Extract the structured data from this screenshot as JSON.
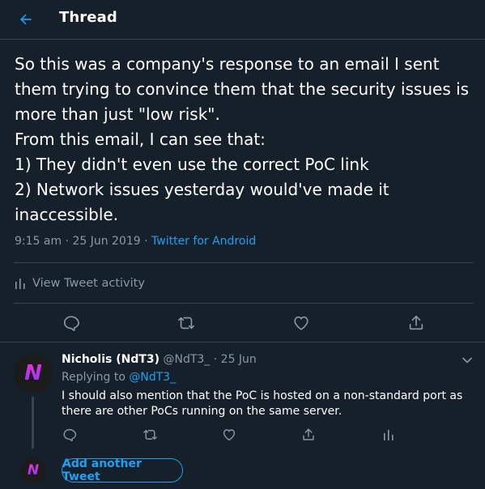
{
  "header": {
    "title": "Thread",
    "back_icon": "arrow-left-icon"
  },
  "tweet": {
    "text": "So this was a company's response to an email I sent them trying to convince them that the security issues is more than just \"low risk\".\nFrom this email, I can see that:\n1) They didn't even use the correct PoC link\n2) Network issues yesterday would've made it inaccessible.",
    "timestamp": "9:15 am · 25 Jun 2019 · ",
    "source": "Twitter for Android",
    "activity_label": "View Tweet activity"
  },
  "reply": {
    "avatar_letter": "N",
    "name": "Nicholis (NdT3)",
    "handle": "@NdT3_",
    "date_sep": " · 25 Jun",
    "replying_prefix": "Replying to ",
    "replying_handle": "@NdT3_",
    "text": "I should also mention that the PoC is hosted on a non-standard port as there are other PoCs running on the same server."
  },
  "composer": {
    "avatar_letter": "N",
    "add_label": "Add another Tweet"
  },
  "colors": {
    "background": "#15202b",
    "accent": "#1da1f2",
    "muted": "#8899a6",
    "border": "#38444d"
  }
}
